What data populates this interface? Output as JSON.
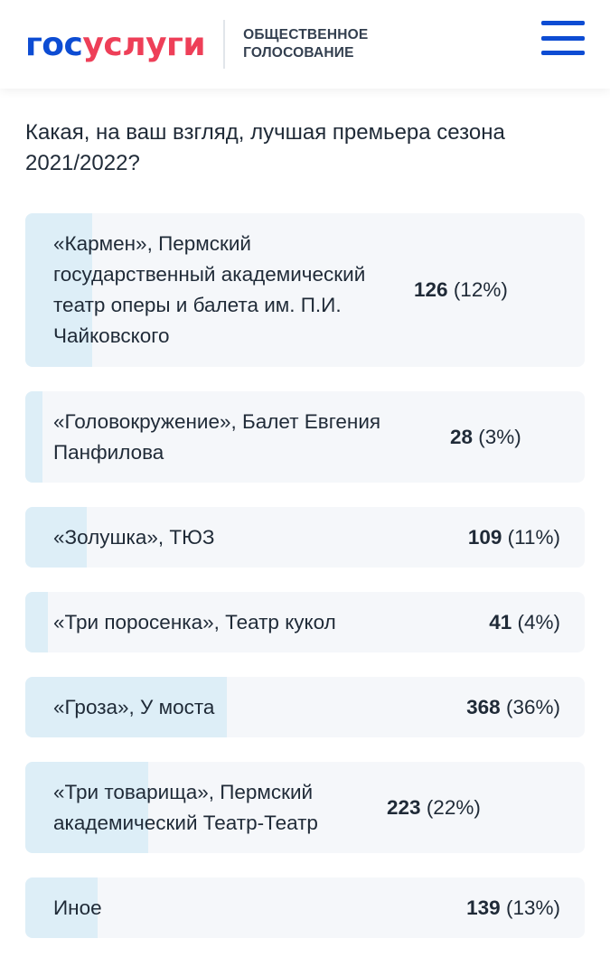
{
  "header": {
    "logo_part1": "гос",
    "logo_part2": "услуги",
    "subtitle_line1": "ОБЩЕСТВЕННОЕ",
    "subtitle_line2": "ГОЛОСОВАНИЕ",
    "menu_icon": "hamburger-menu-icon"
  },
  "colors": {
    "brand_blue": "#0d4cd3",
    "brand_red": "#ee3f58",
    "option_bg": "#f5f7fa",
    "option_fill": "#ddeef7"
  },
  "poll": {
    "question": "Какая, на ваш взгляд, лучшая премьера сезона 2021/2022?",
    "options": [
      {
        "label": "«Кармен», Пермский государственный академический театр оперы и балета им. П.И. Чайковского",
        "count": "126",
        "percent": "(12%)",
        "share": 0.12
      },
      {
        "label": "«Головокружение», Балет Евгения Панфилова",
        "count": "28",
        "percent": "(3%)",
        "share": 0.03
      },
      {
        "label": "«Золушка», ТЮЗ",
        "count": "109",
        "percent": "(11%)",
        "share": 0.11
      },
      {
        "label": "«Три поросенка», Театр кукол",
        "count": "41",
        "percent": "(4%)",
        "share": 0.04
      },
      {
        "label": "«Гроза», У моста",
        "count": "368",
        "percent": "(36%)",
        "share": 0.36
      },
      {
        "label": "«Три товарища», Пермский академический Театр-Театр",
        "count": "223",
        "percent": "(22%)",
        "share": 0.22
      },
      {
        "label": "Иное",
        "count": "139",
        "percent": "(13%)",
        "share": 0.13
      }
    ]
  }
}
